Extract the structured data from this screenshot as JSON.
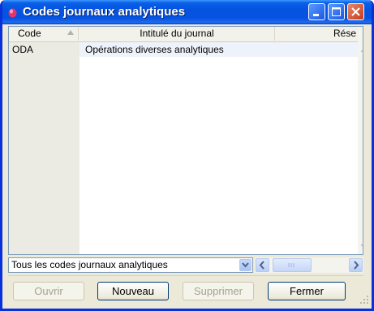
{
  "window": {
    "title": "Codes journaux analytiques"
  },
  "list": {
    "columns": [
      "Code",
      "Intitulé du journal",
      "Rése"
    ],
    "rows": [
      {
        "code": "ODA",
        "label": "Opérations diverses analytiques"
      }
    ]
  },
  "filter": {
    "selected": "Tous les codes journaux analytiques"
  },
  "buttons": {
    "open": "Ouvrir",
    "new": "Nouveau",
    "delete": "Supprimer",
    "close": "Fermer"
  },
  "colors": {
    "titlebar": "#0553e0",
    "accent_close": "#c4391c"
  }
}
